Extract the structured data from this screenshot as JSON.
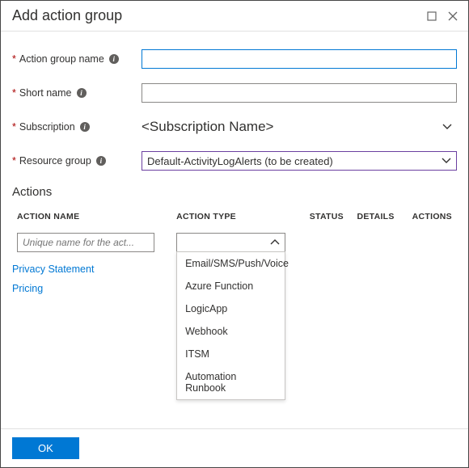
{
  "title": "Add action group",
  "fields": {
    "action_group_name": {
      "label": "Action group name",
      "value": ""
    },
    "short_name": {
      "label": "Short name",
      "value": ""
    },
    "subscription": {
      "label": "Subscription",
      "value": "<Subscription Name>"
    },
    "resource_group": {
      "label": "Resource group",
      "value": "Default-ActivityLogAlerts (to be created)"
    }
  },
  "actions_section": {
    "heading": "Actions",
    "columns": {
      "name": "ACTION NAME",
      "type": "ACTION TYPE",
      "status": "STATUS",
      "details": "DETAILS",
      "actions": "ACTIONS"
    },
    "name_placeholder": "Unique name for the act...",
    "type_options": [
      "Email/SMS/Push/Voice",
      "Azure Function",
      "LogicApp",
      "Webhook",
      "ITSM",
      "Automation Runbook"
    ]
  },
  "links": {
    "privacy": "Privacy Statement",
    "pricing": "Pricing"
  },
  "buttons": {
    "ok": "OK"
  }
}
